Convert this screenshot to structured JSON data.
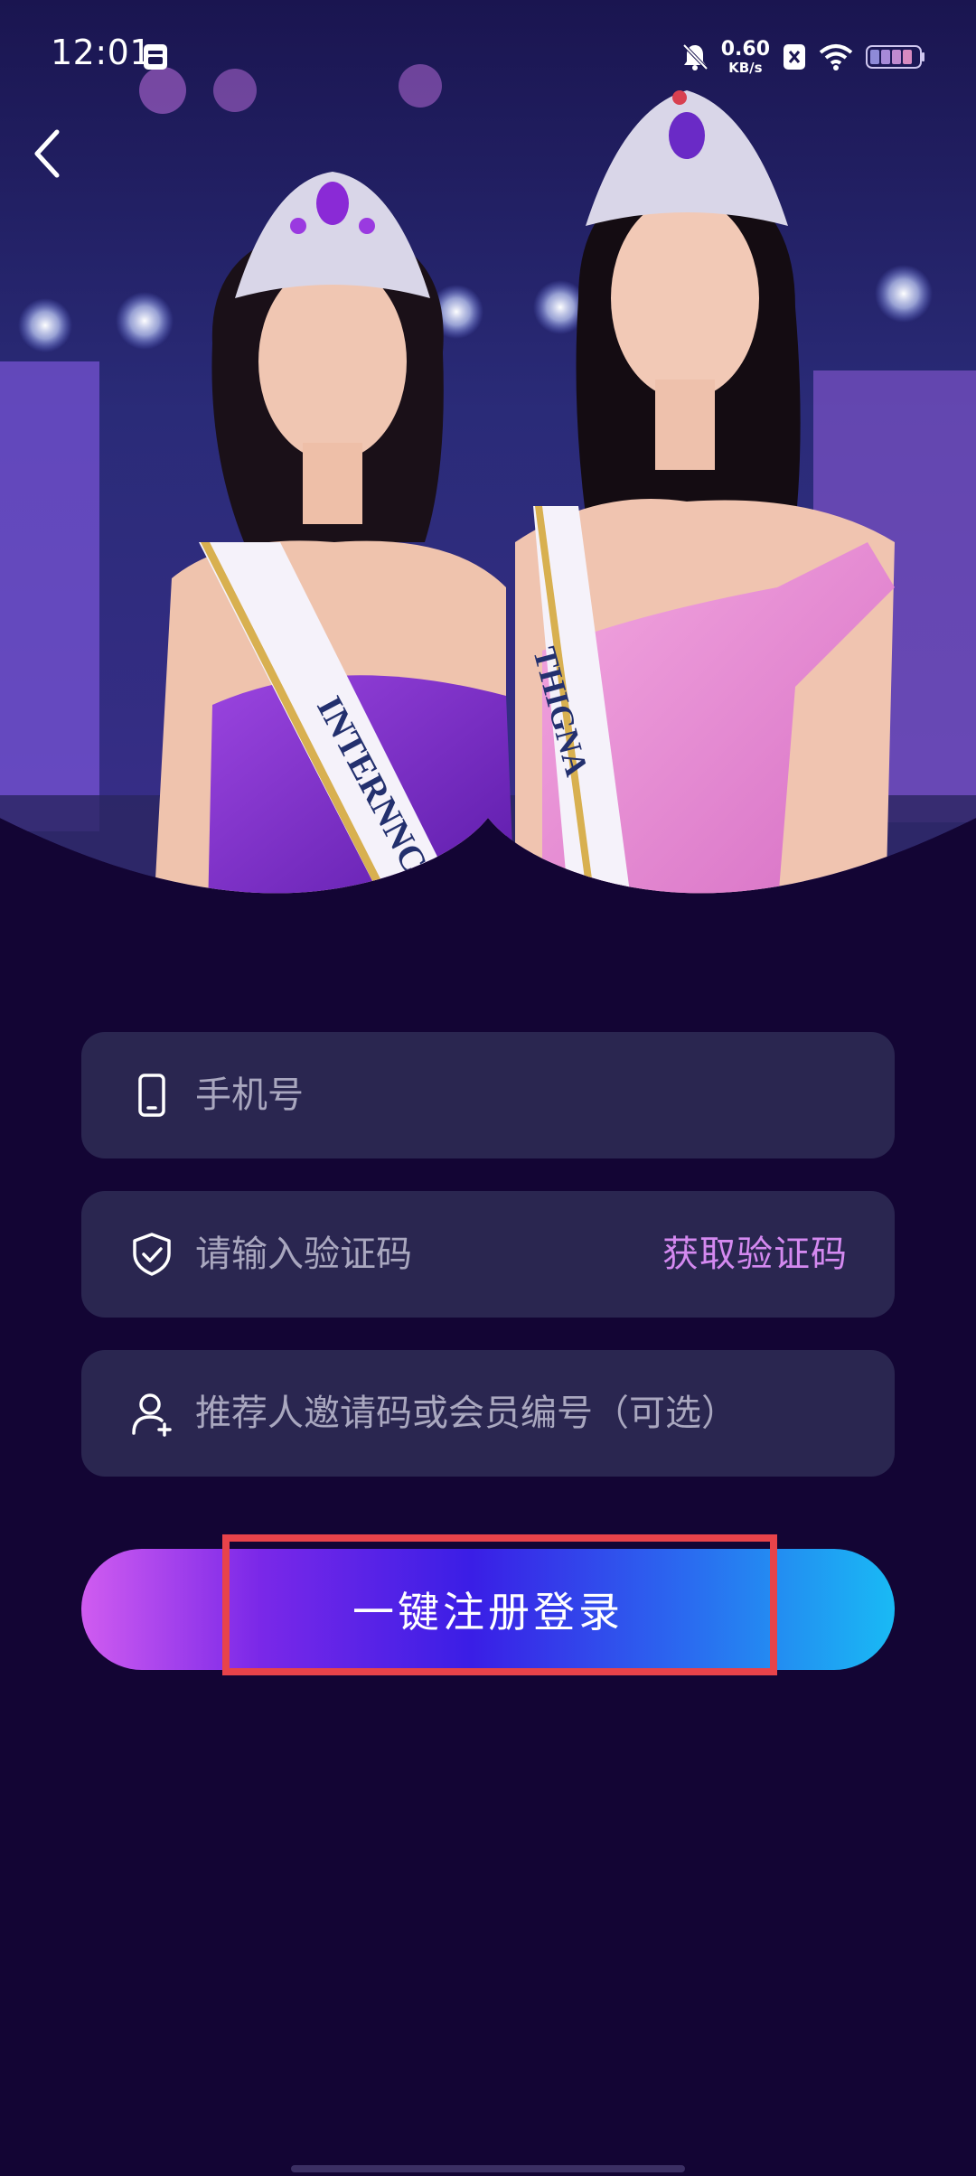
{
  "status_bar": {
    "time": "12:01",
    "net_speed_value": "0.60",
    "net_speed_unit": "KB/s"
  },
  "hero": {
    "sash_left_text": "INTERNNC",
    "sash_right_text": "THIGNA"
  },
  "form": {
    "phone_placeholder": "手机号",
    "code_placeholder": "请输入验证码",
    "get_code_label": "获取验证码",
    "invite_placeholder": "推荐人邀请码或会员编号（可选）"
  },
  "register_button_label": "一键注册登录",
  "colors": {
    "background": "#130534",
    "field_background": "#2a2650",
    "link_accent": "#d489f0",
    "highlight_box": "#e8434a"
  },
  "icons": {
    "back": "chevron-left-icon",
    "phone": "phone-icon",
    "code": "shield-check-icon",
    "invite": "user-add-icon"
  }
}
